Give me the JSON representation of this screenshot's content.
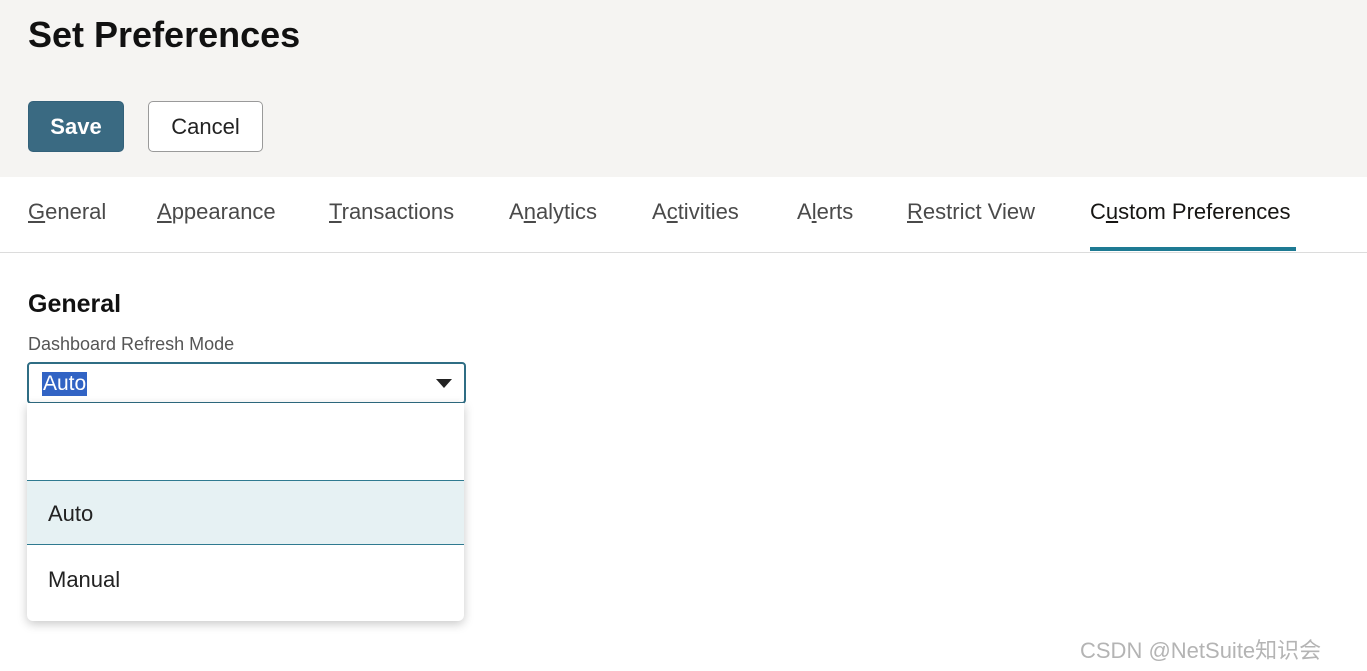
{
  "header": {
    "title": "Set Preferences",
    "save_label": "Save",
    "cancel_label": "Cancel"
  },
  "tabs": [
    {
      "pre": "",
      "mn": "G",
      "post": "eneral",
      "active": false
    },
    {
      "pre": "",
      "mn": "A",
      "post": "ppearance",
      "active": false
    },
    {
      "pre": "",
      "mn": "T",
      "post": "ransactions",
      "active": false
    },
    {
      "pre": "A",
      "mn": "n",
      "post": "alytics",
      "active": false
    },
    {
      "pre": "A",
      "mn": "c",
      "post": "tivities",
      "active": false
    },
    {
      "pre": "A",
      "mn": "l",
      "post": "erts",
      "active": false
    },
    {
      "pre": "",
      "mn": "R",
      "post": "estrict View",
      "active": false
    },
    {
      "pre": "C",
      "mn": "u",
      "post": "stom Preferences",
      "active": true
    }
  ],
  "section": {
    "title": "General",
    "field_label": "Dashboard Refresh Mode",
    "selected_value": "Auto",
    "options": [
      "",
      "Auto",
      "Manual"
    ]
  },
  "watermark": "CSDN @NetSuite知识会",
  "colors": {
    "header_bg": "#f5f4f2",
    "save_button": "#3a6a82",
    "accent": "#1e7a93",
    "selected_option_bg": "#e6f1f3",
    "text_highlight": "#3163c4"
  }
}
